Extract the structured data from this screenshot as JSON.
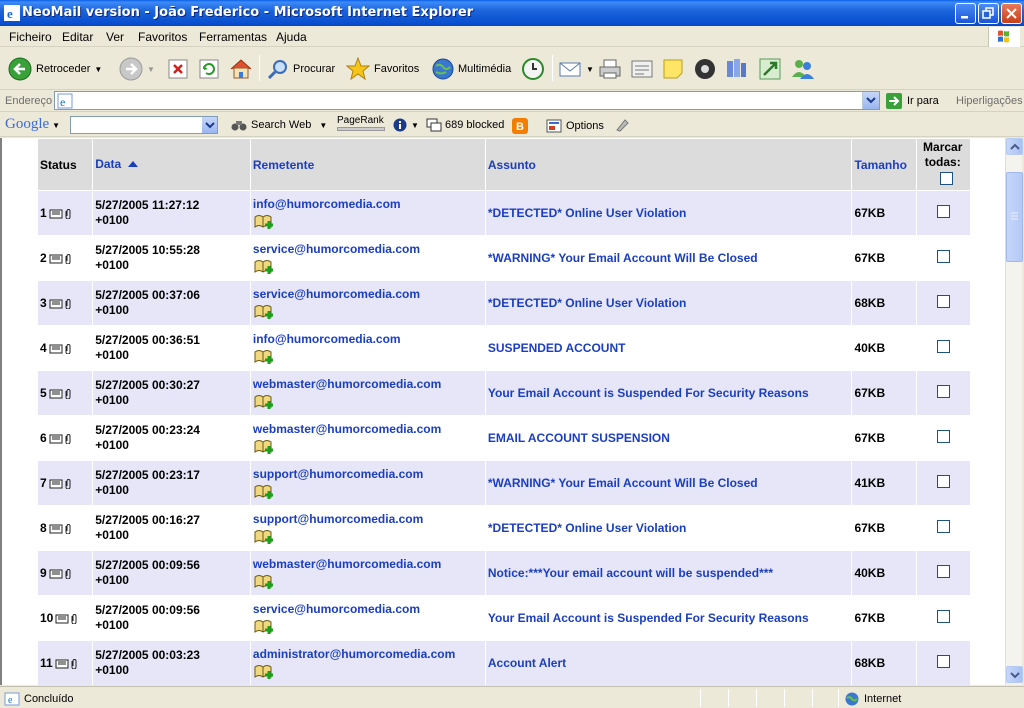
{
  "window": {
    "title": "NeoMail version - João Frederico - Microsoft Internet Explorer"
  },
  "menu": [
    "Ficheiro",
    "Editar",
    "Ver",
    "Favoritos",
    "Ferramentas",
    "Ajuda"
  ],
  "toolbar": {
    "back_label": "Retroceder",
    "search_label": "Procurar",
    "favorites_label": "Favoritos",
    "multimedia_label": "Multimédia"
  },
  "address": {
    "label": "Endereço",
    "value": "",
    "go_label": "Ir para",
    "links_label": "Hiperligações"
  },
  "google_bar": {
    "logo": "Google",
    "search_value": "",
    "search_web_label": "Search Web",
    "pagerank_label": "PageRank",
    "blocked_label": "689 blocked",
    "options_label": "Options"
  },
  "table": {
    "headers": {
      "status": "Status",
      "date": "Data",
      "sender": "Remetente",
      "subject": "Assunto",
      "size": "Tamanho",
      "mark_all": "Marcar todas:"
    },
    "rows": [
      {
        "num": "1",
        "date": "5/27/2005 11:27:12",
        "tz": "+0100",
        "sender": "info@humorcomedia.com",
        "subject": "*DETECTED* Online User Violation",
        "size": "67KB"
      },
      {
        "num": "2",
        "date": "5/27/2005 10:55:28",
        "tz": "+0100",
        "sender": "service@humorcomedia.com",
        "subject": "*WARNING* Your Email Account Will Be Closed",
        "size": "67KB"
      },
      {
        "num": "3",
        "date": "5/27/2005 00:37:06",
        "tz": "+0100",
        "sender": "service@humorcomedia.com",
        "subject": "*DETECTED* Online User Violation",
        "size": "68KB"
      },
      {
        "num": "4",
        "date": "5/27/2005 00:36:51",
        "tz": "+0100",
        "sender": "info@humorcomedia.com",
        "subject": "SUSPENDED ACCOUNT",
        "size": "40KB"
      },
      {
        "num": "5",
        "date": "5/27/2005 00:30:27",
        "tz": "+0100",
        "sender": "webmaster@humorcomedia.com",
        "subject": "Your Email Account is Suspended For Security Reasons",
        "size": "67KB"
      },
      {
        "num": "6",
        "date": "5/27/2005 00:23:24",
        "tz": "+0100",
        "sender": "webmaster@humorcomedia.com",
        "subject": "EMAIL ACCOUNT SUSPENSION",
        "size": "67KB"
      },
      {
        "num": "7",
        "date": "5/27/2005 00:23:17",
        "tz": "+0100",
        "sender": "support@humorcomedia.com",
        "subject": "*WARNING* Your Email Account Will Be Closed",
        "size": "41KB"
      },
      {
        "num": "8",
        "date": "5/27/2005 00:16:27",
        "tz": "+0100",
        "sender": "support@humorcomedia.com",
        "subject": "*DETECTED* Online User Violation",
        "size": "67KB"
      },
      {
        "num": "9",
        "date": "5/27/2005 00:09:56",
        "tz": "+0100",
        "sender": "webmaster@humorcomedia.com",
        "subject": "Notice:***Your email account will be suspended***",
        "size": "40KB"
      },
      {
        "num": "10",
        "date": "5/27/2005 00:09:56",
        "tz": "+0100",
        "sender": "service@humorcomedia.com",
        "subject": "Your Email Account is Suspended For Security Reasons",
        "size": "67KB"
      },
      {
        "num": "11",
        "date": "5/27/2005 00:03:23",
        "tz": "+0100",
        "sender": "administrator@humorcomedia.com",
        "subject": "Account Alert",
        "size": "68KB"
      }
    ]
  },
  "status_bar": {
    "status": "Concluído",
    "zone": "Internet"
  },
  "colors": {
    "link": "#1a3ec0",
    "row_alt": "#e6e6f8",
    "header_bg": "#dcdcdc",
    "titlebar": "#0a4fd0"
  }
}
